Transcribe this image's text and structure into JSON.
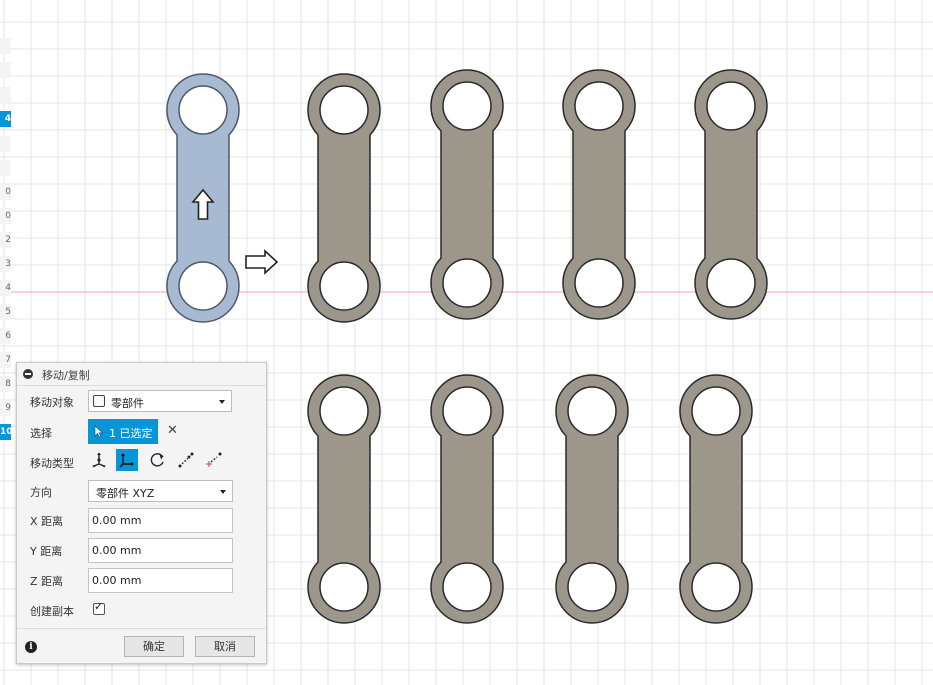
{
  "timeline": {
    "items": [
      {
        "label": "",
        "active": false
      },
      {
        "label": "",
        "active": false
      },
      {
        "label": "",
        "active": false
      },
      {
        "label": "4",
        "active": true
      },
      {
        "label": "",
        "active": false
      },
      {
        "label": "",
        "active": false
      },
      {
        "label": "0",
        "active": false
      },
      {
        "label": "0",
        "active": false
      },
      {
        "label": "2",
        "active": false
      },
      {
        "label": "3",
        "active": false
      },
      {
        "label": "4",
        "active": false
      },
      {
        "label": "5",
        "active": false
      },
      {
        "label": "6",
        "active": false
      },
      {
        "label": "7",
        "active": false
      },
      {
        "label": "8",
        "active": false
      },
      {
        "label": "9",
        "active": false
      },
      {
        "label": "10",
        "active": true
      }
    ]
  },
  "canvas": {
    "background": "#ffffff",
    "grid_color": "#e5e5e5",
    "axis_color": "#f2a3a3",
    "part_fill": "#9c978a",
    "part_stroke": "#2a2a2a",
    "selected_fill": "#a8b9d2",
    "selected_stroke": "#4a5a6a",
    "selected_part": {
      "arrow_icon": "up-arrow-manipulator"
    },
    "move_arrow_icon": "right-arrow-manipulator",
    "parts": [
      {
        "name": "link-part-row1-col1",
        "selected": true
      },
      {
        "name": "link-part-row1-col2",
        "selected": false
      },
      {
        "name": "link-part-row1-col3",
        "selected": false
      },
      {
        "name": "link-part-row1-col4",
        "selected": false
      },
      {
        "name": "link-part-row1-col5",
        "selected": false
      },
      {
        "name": "link-part-row2-col1",
        "selected": false
      },
      {
        "name": "link-part-row2-col2",
        "selected": false
      },
      {
        "name": "link-part-row2-col3",
        "selected": false
      },
      {
        "name": "link-part-row2-col4",
        "selected": false
      }
    ]
  },
  "panel": {
    "title": "移动/复制",
    "accent": "#0696d7",
    "move_object": {
      "label": "移动对象",
      "value": "零部件",
      "icon": "component-box-icon"
    },
    "selection": {
      "label": "选择",
      "value": "1 已选定",
      "clear_icon": "close-icon"
    },
    "move_type": {
      "label": "移动类型",
      "options": [
        {
          "name": "free-move-icon",
          "selected": false
        },
        {
          "name": "translate-icon",
          "selected": true
        },
        {
          "name": "rotate-icon",
          "selected": false
        },
        {
          "name": "point-to-point-icon",
          "selected": false
        },
        {
          "name": "point-to-position-icon",
          "selected": false
        }
      ]
    },
    "direction": {
      "label": "方向",
      "value": "零部件 XYZ"
    },
    "x_distance": {
      "label": "X 距离",
      "value": "0.00 mm"
    },
    "y_distance": {
      "label": "Y 距离",
      "value": "0.00 mm"
    },
    "z_distance": {
      "label": "Z 距离",
      "value": "0.00 mm"
    },
    "create_copy": {
      "label": "创建副本",
      "checked": true
    },
    "ok_label": "确定",
    "cancel_label": "取消"
  }
}
